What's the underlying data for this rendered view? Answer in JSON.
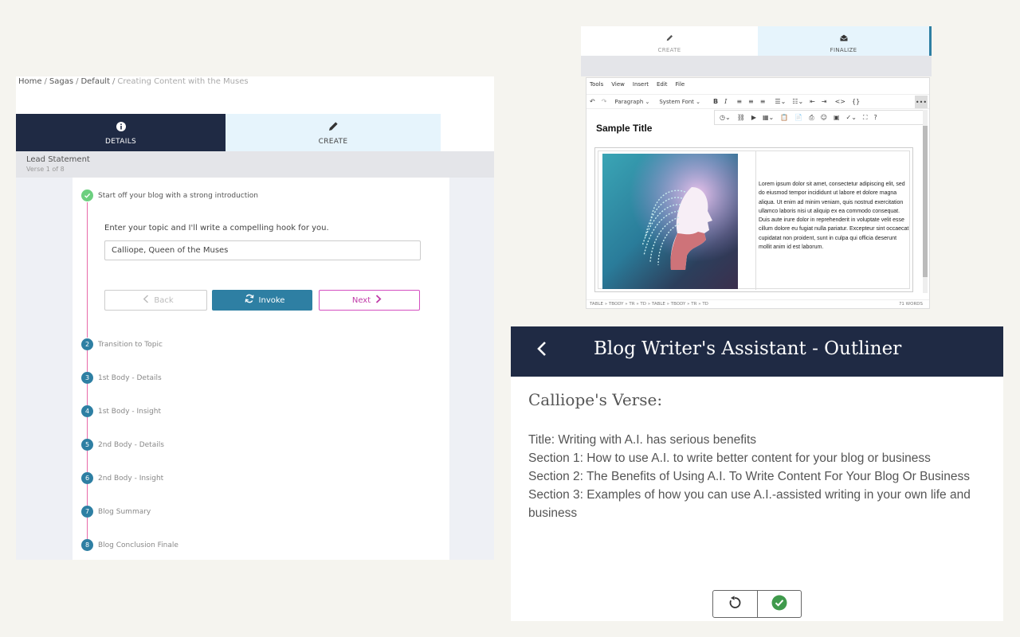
{
  "breadcrumb": {
    "items": [
      "Home",
      "Sagas",
      "Default"
    ],
    "current": "Creating Content with the Muses"
  },
  "left_tabs": {
    "details": "DETAILS",
    "create": "CREATE"
  },
  "section": {
    "title": "Lead Statement",
    "subtitle": "Verse 1 of 8"
  },
  "steps": [
    {
      "num": "",
      "label": "Start off your blog with a strong introduction"
    },
    {
      "num": "2",
      "label": "Transition to Topic"
    },
    {
      "num": "3",
      "label": "1st Body - Details"
    },
    {
      "num": "4",
      "label": "1st Body - Insight"
    },
    {
      "num": "5",
      "label": "2nd Body - Details"
    },
    {
      "num": "6",
      "label": "2nd Body - Insight"
    },
    {
      "num": "7",
      "label": "Blog Summary"
    },
    {
      "num": "8",
      "label": "Blog Conclusion Finale"
    }
  ],
  "form": {
    "prompt": "Enter your topic and I'll write a compelling hook for you.",
    "input_value": "Calliope, Queen of the Muses",
    "back_label": "Back",
    "invoke_label": "Invoke",
    "next_label": "Next"
  },
  "editor": {
    "tab_create": "CREATE",
    "tab_finalize": "FINALIZE",
    "menu": [
      "Tools",
      "View",
      "Insert",
      "Edit",
      "File"
    ],
    "block_format": "Paragraph",
    "font": "System Font",
    "doc_title": "Sample Title",
    "body_text": "Lorem ipsum dolor sit amet, consectetur adipiscing elit, sed do eiusmod tempor incididunt ut labore et dolore magna aliqua. Ut enim ad minim veniam, quis nostrud exercitation ullamco laboris nisi ut aliquip ex ea commodo consequat. Duis aute irure dolor in reprehenderit in voluptate velit esse cillum dolore eu fugiat nulla pariatur. Excepteur sint occaecat cupidatat non proident, sunt in culpa qui officia deserunt mollit anim id est laborum.",
    "status_path": "TABLE » TBODY » TR » TD » TABLE » TBODY » TR » TD",
    "word_count": "71 WORDS"
  },
  "outliner": {
    "title": "Blog Writer's Assistant - Outliner",
    "verse_heading": "Calliope's Verse:",
    "lines": [
      "Title: Writing with A.I. has serious benefits",
      "Section 1: How to use A.I. to write better content for your blog or business",
      "Section 2: The Benefits of Using A.I. To Write Content For Your Blog Or Business",
      "Section 3: Examples of how you can use A.I.-assisted writing in your own life and business"
    ]
  },
  "colors": {
    "navy": "#1f2a44",
    "teal": "#2e7fa3",
    "magenta": "#c03aa8",
    "pink_line": "#e86aa8",
    "success_green": "#6ccf7f"
  }
}
